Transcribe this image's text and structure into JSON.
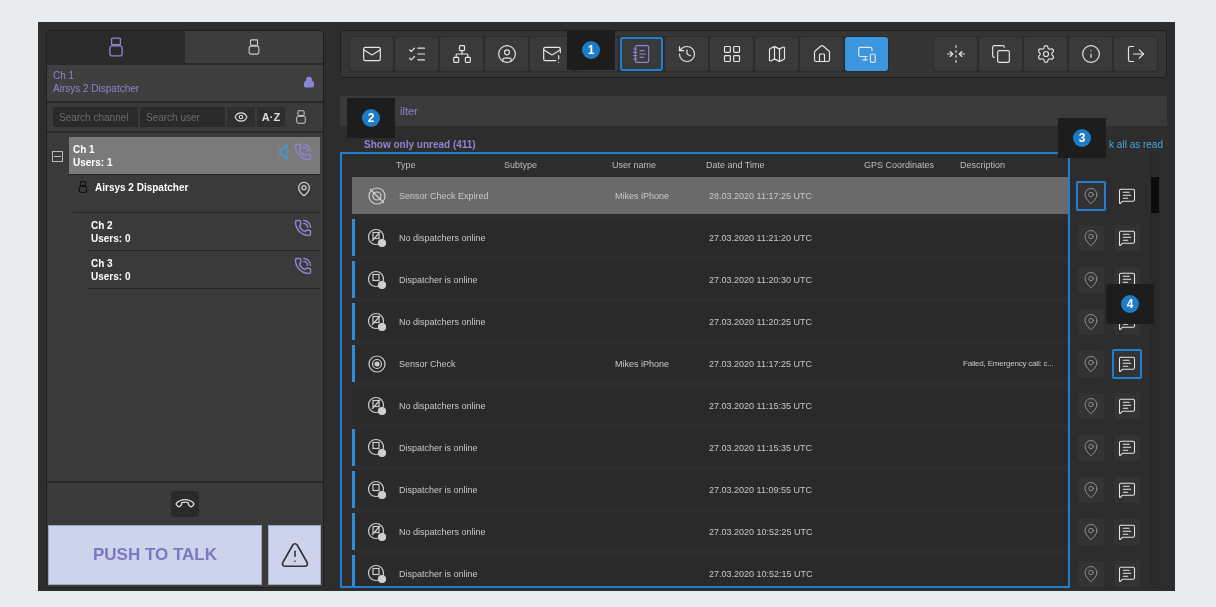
{
  "left_panel": {
    "tabs": [
      {
        "selected": true
      },
      {
        "selected": false
      }
    ],
    "header": {
      "channel": "Ch 1",
      "user": "Airsys 2 Dispatcher",
      "locked": true
    },
    "search": {
      "channel_placeholder": "Search channel",
      "user_placeholder": "Search user",
      "sort_label": "A·Z"
    },
    "tree": [
      {
        "kind": "channel",
        "name": "Ch 1",
        "users": "Users: 1",
        "selected": true,
        "expanded": true,
        "speaker": true,
        "children": [
          {
            "kind": "user",
            "name": "Airsys 2 Dispatcher",
            "selected": false
          },
          {
            "kind": "channel",
            "name": "Ch 2",
            "users": "Users: 0",
            "selected": false,
            "speaker": false
          },
          {
            "kind": "channel",
            "name": "Ch 3",
            "users": "Users: 0",
            "selected": false,
            "speaker": false
          }
        ]
      }
    ],
    "ptt_label": "PUSH TO TALK"
  },
  "toolbar": {
    "groups": [
      [
        {
          "selected": false,
          "highlighted": false
        },
        {
          "selected": false,
          "highlighted": false
        },
        {
          "selected": false,
          "highlighted": false
        },
        {
          "selected": false,
          "highlighted": false
        },
        {
          "selected": false,
          "highlighted": false
        },
        {
          "selected": false,
          "highlighted": false
        },
        {
          "selected": false,
          "highlighted": true
        },
        {
          "selected": false,
          "highlighted": false
        },
        {
          "selected": false,
          "highlighted": false
        },
        {
          "selected": false,
          "highlighted": false
        },
        {
          "selected": false,
          "highlighted": false
        },
        {
          "selected": true,
          "highlighted": false
        }
      ],
      [
        {
          "selected": false,
          "highlighted": false
        },
        {
          "selected": false,
          "highlighted": false
        },
        {
          "selected": false,
          "highlighted": false
        },
        {
          "selected": false,
          "highlighted": false
        },
        {
          "selected": false,
          "highlighted": false
        }
      ]
    ]
  },
  "filter": {
    "label": "ilter"
  },
  "unread_toggle": {
    "label": "Show only unread (411)"
  },
  "mark_all": "k all as read",
  "table": {
    "highlighted": true,
    "columns": [
      "Type",
      "Subtype",
      "User name",
      "Date and Time",
      "GPS Coordinates",
      "Description"
    ],
    "rows": [
      {
        "kind": "sensor_expired",
        "type": "Sensor Check Expired",
        "user_name": "Mikes iPhone",
        "date_time": "28.03.2020 11:17:25 UTC",
        "unread": false,
        "selected": true,
        "location_highlighted": true,
        "message_highlighted": false
      },
      {
        "kind": "dispatcher_offline",
        "type": "No dispatchers online",
        "date_time": "27.03.2020 11:21:20 UTC",
        "unread": true,
        "selected": false,
        "location_highlighted": false,
        "message_highlighted": false
      },
      {
        "kind": "dispatcher_online",
        "type": "Dispatcher is online",
        "date_time": "27.03.2020 11:20:30 UTC",
        "unread": true,
        "selected": false,
        "location_highlighted": false,
        "message_highlighted": false
      },
      {
        "kind": "dispatcher_offline",
        "type": "No dispatchers online",
        "date_time": "27.03.2020 11:20:25 UTC",
        "unread": true,
        "selected": false,
        "location_highlighted": false,
        "message_highlighted": false
      },
      {
        "kind": "sensor",
        "type": "Sensor Check",
        "user_name": "Mikes iPhone",
        "date_time": "27.03.2020 11:17:25 UTC",
        "description": "Failed, Emergency call: c...",
        "unread": true,
        "selected": false,
        "location_highlighted": false,
        "message_highlighted": true
      },
      {
        "kind": "dispatcher_offline",
        "type": "No dispatchers online",
        "date_time": "27.03.2020 11:15:35 UTC",
        "unread": false,
        "selected": false,
        "location_highlighted": false,
        "message_highlighted": false
      },
      {
        "kind": "dispatcher_online",
        "type": "Dispatcher is online",
        "date_time": "27.03.2020 11:15:35 UTC",
        "unread": true,
        "selected": false,
        "location_highlighted": false,
        "message_highlighted": false
      },
      {
        "kind": "dispatcher_online",
        "type": "Dispatcher is online",
        "date_time": "27.03.2020 11:09:55 UTC",
        "unread": true,
        "selected": false,
        "location_highlighted": false,
        "message_highlighted": false
      },
      {
        "kind": "dispatcher_offline",
        "type": "No dispatchers online",
        "date_time": "27.03.2020 10:52:25 UTC",
        "unread": true,
        "selected": false,
        "location_highlighted": false,
        "message_highlighted": false
      },
      {
        "kind": "dispatcher_online",
        "type": "Dispatcher is online",
        "date_time": "27.03.2020 10:52:15 UTC",
        "unread": true,
        "selected": false,
        "location_highlighted": false,
        "message_highlighted": false
      }
    ]
  },
  "callouts": [
    "1",
    "2",
    "3",
    "4"
  ]
}
